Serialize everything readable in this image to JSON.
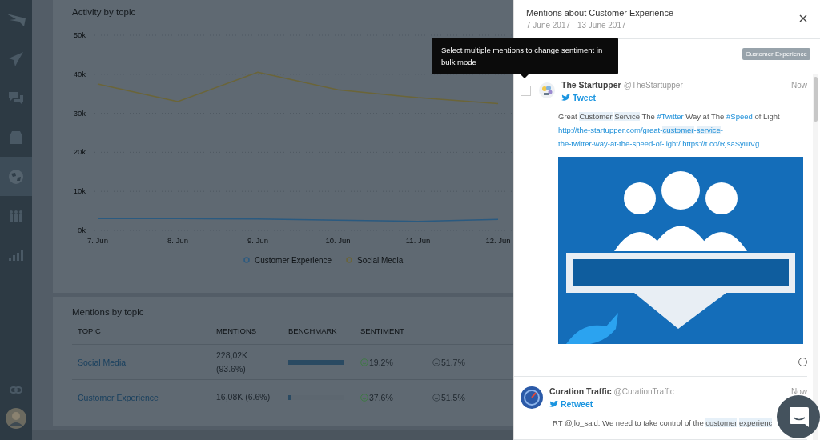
{
  "sidebar": {
    "items": [
      {
        "kind": "logo",
        "selected": false
      },
      {
        "kind": "send",
        "selected": false
      },
      {
        "kind": "chat",
        "selected": false
      },
      {
        "kind": "box",
        "selected": false
      },
      {
        "kind": "globe",
        "selected": true
      },
      {
        "kind": "people",
        "selected": false
      },
      {
        "kind": "bars",
        "selected": false
      }
    ],
    "bottom": [
      {
        "kind": "link"
      },
      {
        "kind": "avatar"
      }
    ]
  },
  "activity": {
    "title": "Activity by topic",
    "chart_data": {
      "type": "line",
      "grid": true,
      "legend": true,
      "categories": [
        "7. Jun",
        "8. Jun",
        "9. Jun",
        "10. Jun",
        "11. Jun",
        "12. Jun"
      ],
      "ylim": [
        0,
        50000
      ],
      "yticks": [
        {
          "value": 0,
          "label": "0k"
        },
        {
          "value": 10000,
          "label": "10k"
        },
        {
          "value": 20000,
          "label": "20k"
        },
        {
          "value": 30000,
          "label": "30k"
        },
        {
          "value": 40000,
          "label": "40k"
        },
        {
          "value": 50000,
          "label": "50k"
        }
      ],
      "series": [
        {
          "name": "Customer Experience",
          "color": "#2a5a80",
          "values": [
            3000,
            3000,
            2900,
            2600,
            2300,
            2800
          ]
        },
        {
          "name": "Social Media",
          "color": "#6b6538",
          "values": [
            37500,
            33000,
            40500,
            36000,
            34000,
            32500
          ]
        }
      ]
    }
  },
  "mentions_by_topic": {
    "title": "Mentions by topic",
    "columns": [
      "TOPIC",
      "MENTIONS",
      "BENCHMARK",
      "SENTIMENT"
    ],
    "rows": [
      {
        "topic": "Social Media",
        "mentions": "228,02K (93.6%)",
        "benchmark": {
          "level": 1
        },
        "positive": "19.2%",
        "neutral": "51.7%"
      },
      {
        "topic": "Customer Experience",
        "mentions": "16,08K (6.6%)",
        "benchmark": {
          "level": 0.06
        },
        "positive": "37.6%",
        "neutral": "51.5%"
      }
    ]
  },
  "tooltip": {
    "text": "Select multiple mentions to change sentiment in bulk mode"
  },
  "panel": {
    "title": "Mentions about Customer Experience",
    "date_range": "7 June 2017 - 13 June 2017",
    "filter_tag": "Customer Experience",
    "mentions": [
      {
        "hovered": true,
        "avatar": {
          "kind": "bulbs"
        },
        "author": "The Startupper",
        "handle": "@TheStartupper",
        "time": "Now",
        "type": "Tweet",
        "segments": [
          {
            "kind": "text",
            "text": "Great "
          },
          {
            "kind": "mark",
            "text": "Customer"
          },
          {
            "kind": "mark",
            "space_before": true,
            "text": "Service"
          },
          {
            "kind": "text",
            "text": " The "
          },
          {
            "kind": "link",
            "parts": [
              {
                "text": "#Twitter",
                "mark": false
              }
            ]
          },
          {
            "kind": "text",
            "text": " Way at The "
          },
          {
            "kind": "link",
            "parts": [
              {
                "text": "#Speed",
                "mark": false
              }
            ]
          },
          {
            "kind": "text",
            "text": " of Light "
          },
          {
            "kind": "link",
            "parts": [
              {
                "text": "http://the-startupper.com/great-",
                "mark": false
              },
              {
                "text": "customer",
                "mark": true
              },
              {
                "text": "-",
                "mark": false
              },
              {
                "text": "service",
                "mark": true
              },
              {
                "text": "-",
                "mark": false
              }
            ]
          },
          {
            "kind": "link",
            "parts": [
              {
                "text": "the-twitter-way-at-the-speed-of-light/",
                "mark": false
              }
            ]
          },
          {
            "kind": "link",
            "space_before": true,
            "parts": [
              {
                "text": "https://t.co/RjsaSyuIVg",
                "mark": false
              }
            ]
          }
        ],
        "status_marker": true
      },
      {
        "hovered": false,
        "avatar": {
          "kind": "gauge"
        },
        "author": "Curation Traffic",
        "handle": "@CurationTraffic",
        "time": "Now",
        "type": "Retweet",
        "segments": [
          {
            "kind": "text",
            "text": "RT @jlo_said: We need to take control of the "
          },
          {
            "kind": "mark",
            "text": "customer"
          },
          {
            "kind": "mark",
            "space_before": true,
            "text": "experienc"
          }
        ],
        "status_marker": false
      }
    ]
  }
}
